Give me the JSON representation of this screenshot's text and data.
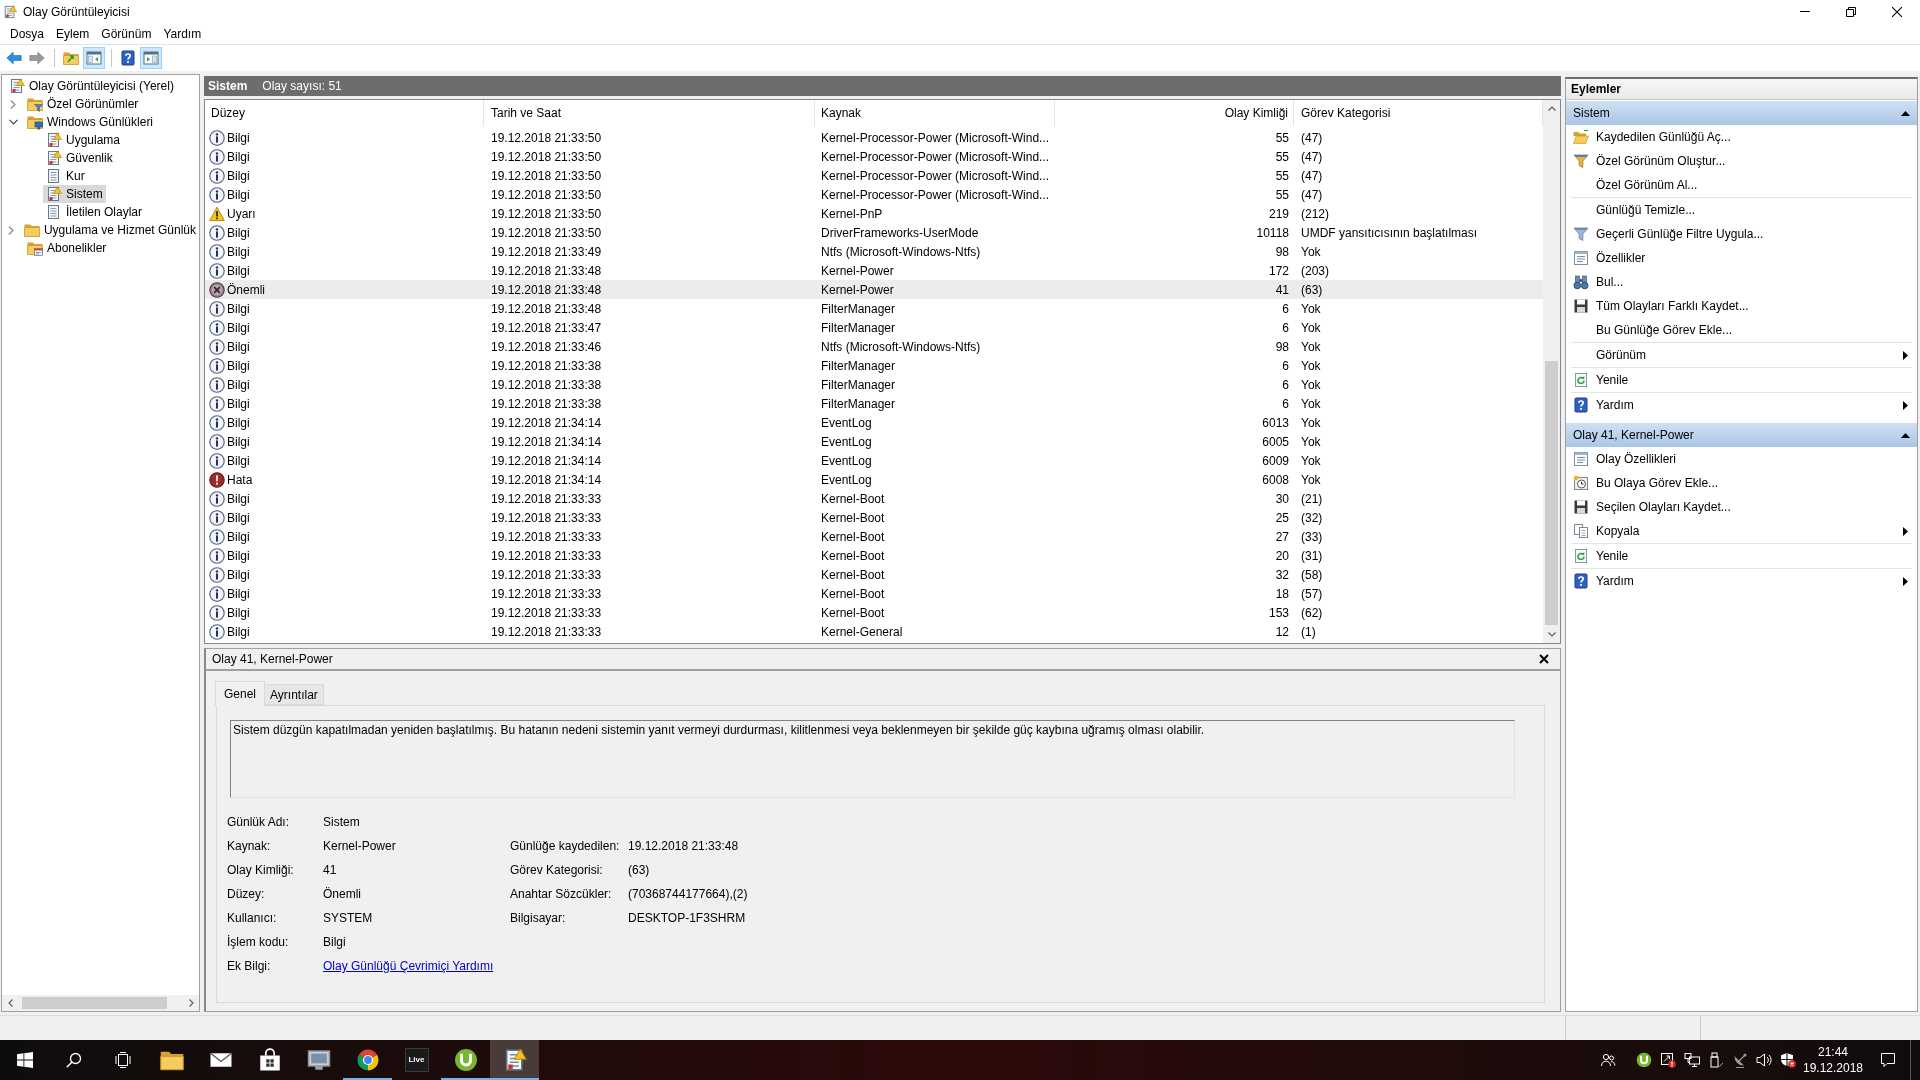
{
  "window": {
    "title": "Olay Görüntüleyicisi"
  },
  "menu": [
    "Dosya",
    "Eylem",
    "Görünüm",
    "Yardım"
  ],
  "toolbar": [
    {
      "kind": "back",
      "on": false,
      "disabled": false
    },
    {
      "kind": "forward",
      "on": false,
      "disabled": true
    },
    {
      "kind": "separator"
    },
    {
      "kind": "folder-up",
      "on": false,
      "disabled": false
    },
    {
      "kind": "tree-pane",
      "on": true,
      "disabled": false
    },
    {
      "kind": "separator"
    },
    {
      "kind": "help",
      "on": false,
      "disabled": false
    },
    {
      "kind": "action-pane",
      "on": true,
      "disabled": false
    }
  ],
  "tree": {
    "label": "Olay Görüntüleyicisi (Yerel)",
    "kind": "root",
    "selected": false,
    "children": [
      {
        "label": "Özel Görünümler",
        "kind": "filter-folder",
        "selected": false,
        "expanded": false
      },
      {
        "label": "Windows Günlükleri",
        "kind": "computer-folder",
        "selected": false,
        "expanded": true,
        "children": [
          {
            "label": "Uygulama",
            "kind": "log-alert",
            "selected": false
          },
          {
            "label": "Güvenlik",
            "kind": "log-alert",
            "selected": false
          },
          {
            "label": "Kur",
            "kind": "log",
            "selected": false
          },
          {
            "label": "Sistem",
            "kind": "log-alert",
            "selected": true
          },
          {
            "label": "İletilen Olaylar",
            "kind": "log",
            "selected": false
          }
        ]
      },
      {
        "label": "Uygulama ve Hizmet Günlük",
        "kind": "folder",
        "selected": false,
        "expanded": false
      },
      {
        "label": "Abonelikler",
        "kind": "subscription-folder",
        "selected": false
      }
    ]
  },
  "center": {
    "title": "Sistem",
    "count": "Olay sayısı: 51"
  },
  "table": {
    "columns": [
      "Düzey",
      "Tarih ve Saat",
      "Kaynak",
      "Olay Kimliği",
      "Görev Kategorisi"
    ],
    "rows": [
      {
        "kind": "info",
        "selected": false,
        "cells": [
          "Bilgi",
          "19.12.2018 21:33:50",
          "Kernel-Processor-Power (Microsoft-Wind...",
          "55",
          "(47)"
        ]
      },
      {
        "kind": "info",
        "selected": false,
        "cells": [
          "Bilgi",
          "19.12.2018 21:33:50",
          "Kernel-Processor-Power (Microsoft-Wind...",
          "55",
          "(47)"
        ]
      },
      {
        "kind": "info",
        "selected": false,
        "cells": [
          "Bilgi",
          "19.12.2018 21:33:50",
          "Kernel-Processor-Power (Microsoft-Wind...",
          "55",
          "(47)"
        ]
      },
      {
        "kind": "info",
        "selected": false,
        "cells": [
          "Bilgi",
          "19.12.2018 21:33:50",
          "Kernel-Processor-Power (Microsoft-Wind...",
          "55",
          "(47)"
        ]
      },
      {
        "kind": "warning",
        "selected": false,
        "cells": [
          "Uyarı",
          "19.12.2018 21:33:50",
          "Kernel-PnP",
          "219",
          "(212)"
        ]
      },
      {
        "kind": "info",
        "selected": false,
        "cells": [
          "Bilgi",
          "19.12.2018 21:33:50",
          "DriverFrameworks-UserMode",
          "10118",
          "UMDF yansıtıcısının başlatılması"
        ]
      },
      {
        "kind": "info",
        "selected": false,
        "cells": [
          "Bilgi",
          "19.12.2018 21:33:49",
          "Ntfs (Microsoft-Windows-Ntfs)",
          "98",
          "Yok"
        ]
      },
      {
        "kind": "info",
        "selected": false,
        "cells": [
          "Bilgi",
          "19.12.2018 21:33:48",
          "Kernel-Power",
          "172",
          "(203)"
        ]
      },
      {
        "kind": "critical",
        "selected": true,
        "cells": [
          "Önemli",
          "19.12.2018 21:33:48",
          "Kernel-Power",
          "41",
          "(63)"
        ]
      },
      {
        "kind": "info",
        "selected": false,
        "cells": [
          "Bilgi",
          "19.12.2018 21:33:48",
          "FilterManager",
          "6",
          "Yok"
        ]
      },
      {
        "kind": "info",
        "selected": false,
        "cells": [
          "Bilgi",
          "19.12.2018 21:33:47",
          "FilterManager",
          "6",
          "Yok"
        ]
      },
      {
        "kind": "info",
        "selected": false,
        "cells": [
          "Bilgi",
          "19.12.2018 21:33:46",
          "Ntfs (Microsoft-Windows-Ntfs)",
          "98",
          "Yok"
        ]
      },
      {
        "kind": "info",
        "selected": false,
        "cells": [
          "Bilgi",
          "19.12.2018 21:33:38",
          "FilterManager",
          "6",
          "Yok"
        ]
      },
      {
        "kind": "info",
        "selected": false,
        "cells": [
          "Bilgi",
          "19.12.2018 21:33:38",
          "FilterManager",
          "6",
          "Yok"
        ]
      },
      {
        "kind": "info",
        "selected": false,
        "cells": [
          "Bilgi",
          "19.12.2018 21:33:38",
          "FilterManager",
          "6",
          "Yok"
        ]
      },
      {
        "kind": "info",
        "selected": false,
        "cells": [
          "Bilgi",
          "19.12.2018 21:34:14",
          "EventLog",
          "6013",
          "Yok"
        ]
      },
      {
        "kind": "info",
        "selected": false,
        "cells": [
          "Bilgi",
          "19.12.2018 21:34:14",
          "EventLog",
          "6005",
          "Yok"
        ]
      },
      {
        "kind": "info",
        "selected": false,
        "cells": [
          "Bilgi",
          "19.12.2018 21:34:14",
          "EventLog",
          "6009",
          "Yok"
        ]
      },
      {
        "kind": "error",
        "selected": false,
        "cells": [
          "Hata",
          "19.12.2018 21:34:14",
          "EventLog",
          "6008",
          "Yok"
        ]
      },
      {
        "kind": "info",
        "selected": false,
        "cells": [
          "Bilgi",
          "19.12.2018 21:33:33",
          "Kernel-Boot",
          "30",
          "(21)"
        ]
      },
      {
        "kind": "info",
        "selected": false,
        "cells": [
          "Bilgi",
          "19.12.2018 21:33:33",
          "Kernel-Boot",
          "25",
          "(32)"
        ]
      },
      {
        "kind": "info",
        "selected": false,
        "cells": [
          "Bilgi",
          "19.12.2018 21:33:33",
          "Kernel-Boot",
          "27",
          "(33)"
        ]
      },
      {
        "kind": "info",
        "selected": false,
        "cells": [
          "Bilgi",
          "19.12.2018 21:33:33",
          "Kernel-Boot",
          "20",
          "(31)"
        ]
      },
      {
        "kind": "info",
        "selected": false,
        "cells": [
          "Bilgi",
          "19.12.2018 21:33:33",
          "Kernel-Boot",
          "32",
          "(58)"
        ]
      },
      {
        "kind": "info",
        "selected": false,
        "cells": [
          "Bilgi",
          "19.12.2018 21:33:33",
          "Kernel-Boot",
          "18",
          "(57)"
        ]
      },
      {
        "kind": "info",
        "selected": false,
        "cells": [
          "Bilgi",
          "19.12.2018 21:33:33",
          "Kernel-Boot",
          "153",
          "(62)"
        ]
      },
      {
        "kind": "info",
        "selected": false,
        "cells": [
          "Bilgi",
          "19.12.2018 21:33:33",
          "Kernel-General",
          "12",
          "(1)"
        ]
      }
    ]
  },
  "details": {
    "title": "Olay 41, Kernel-Power",
    "tabs": [
      {
        "label": "Genel",
        "selected": true
      },
      {
        "label": "Ayrıntılar",
        "selected": false
      }
    ],
    "description": "Sistem düzgün kapatılmadan yeniden başlatılmış. Bu hatanın nedeni sistemin yanıt vermeyi durdurması, kilitlenmesi veya beklenmeyen bir şekilde güç kaybına uğramış olması olabilir.",
    "field_rows": [
      [
        {
          "kind": "text",
          "label": "Günlük Adı:",
          "value": "Sistem"
        }
      ],
      [
        {
          "kind": "text",
          "label": "Kaynak:",
          "value": "Kernel-Power"
        },
        {
          "kind": "text",
          "label": "Günlüğe kaydedilen:",
          "value": "19.12.2018 21:33:48"
        }
      ],
      [
        {
          "kind": "text",
          "label": "Olay Kimliği:",
          "value": "41"
        },
        {
          "kind": "text",
          "label": "Görev Kategorisi:",
          "value": "(63)"
        }
      ],
      [
        {
          "kind": "text",
          "label": "Düzey:",
          "value": "Önemli"
        },
        {
          "kind": "text",
          "label": "Anahtar Sözcükler:",
          "value": "(70368744177664),(2)"
        }
      ],
      [
        {
          "kind": "text",
          "label": "Kullanıcı:",
          "value": "SYSTEM"
        },
        {
          "kind": "text",
          "label": "Bilgisayar:",
          "value": "DESKTOP-1F3SHRM"
        }
      ],
      [
        {
          "kind": "text",
          "label": "İşlem kodu:",
          "value": "Bilgi"
        }
      ],
      [
        {
          "kind": "link",
          "label": "Ek Bilgi:",
          "value": "Olay Günlüğü Çevrimiçi Yardımı"
        }
      ]
    ]
  },
  "actions": {
    "title": "Eylemler",
    "sections": [
      {
        "title": "Sistem",
        "expanded": true,
        "items": [
          {
            "kind": "open",
            "label": "Kaydedilen Günlüğü Aç...",
            "submenu": false
          },
          {
            "kind": "create-view",
            "label": "Özel Görünüm Oluştur...",
            "submenu": false
          },
          {
            "kind": "plain",
            "label": "Özel Görünüm Al...",
            "submenu": false
          },
          {
            "kind": "separator"
          },
          {
            "kind": "plain",
            "label": "Günlüğü Temizle...",
            "submenu": false
          },
          {
            "kind": "filter",
            "label": "Geçerli Günlüğe Filtre Uygula...",
            "submenu": false
          },
          {
            "kind": "properties",
            "label": "Özellikler",
            "submenu": false
          },
          {
            "kind": "find",
            "label": "Bul...",
            "submenu": false
          },
          {
            "kind": "save",
            "label": "Tüm Olayları Farklı Kaydet...",
            "submenu": false
          },
          {
            "kind": "plain",
            "label": "Bu Günlüğe Görev Ekle...",
            "submenu": false
          },
          {
            "kind": "separator"
          },
          {
            "kind": "plain",
            "label": "Görünüm",
            "submenu": true
          },
          {
            "kind": "separator"
          },
          {
            "kind": "refresh",
            "label": "Yenile",
            "submenu": false
          },
          {
            "kind": "separator"
          },
          {
            "kind": "help",
            "label": "Yardım",
            "submenu": true
          }
        ]
      },
      {
        "title": "Olay 41, Kernel-Power",
        "expanded": true,
        "items": [
          {
            "kind": "properties",
            "label": "Olay Özellikleri",
            "submenu": false
          },
          {
            "kind": "add-task",
            "label": "Bu Olaya Görev Ekle...",
            "submenu": false
          },
          {
            "kind": "save",
            "label": "Seçilen Olayları Kaydet...",
            "submenu": false
          },
          {
            "kind": "copy",
            "label": "Kopyala",
            "submenu": true
          },
          {
            "kind": "separator"
          },
          {
            "kind": "refresh",
            "label": "Yenile",
            "submenu": false
          },
          {
            "kind": "separator"
          },
          {
            "kind": "help",
            "label": "Yardım",
            "submenu": true
          }
        ]
      }
    ]
  },
  "taskbar": {
    "apps": [
      {
        "kind": "explorer",
        "running": false,
        "active": false
      },
      {
        "kind": "mail",
        "running": false,
        "active": false
      },
      {
        "kind": "store",
        "running": false,
        "active": false
      },
      {
        "kind": "monitor",
        "running": false,
        "active": false
      },
      {
        "kind": "browser",
        "running": true,
        "active": false
      },
      {
        "kind": "live",
        "label": "Live",
        "running": false,
        "active": false
      },
      {
        "kind": "torrent",
        "running": true,
        "active": false
      },
      {
        "kind": "event-viewer",
        "running": true,
        "active": true
      }
    ],
    "clock": {
      "time": "21:44",
      "date": "19.12.2018"
    }
  }
}
